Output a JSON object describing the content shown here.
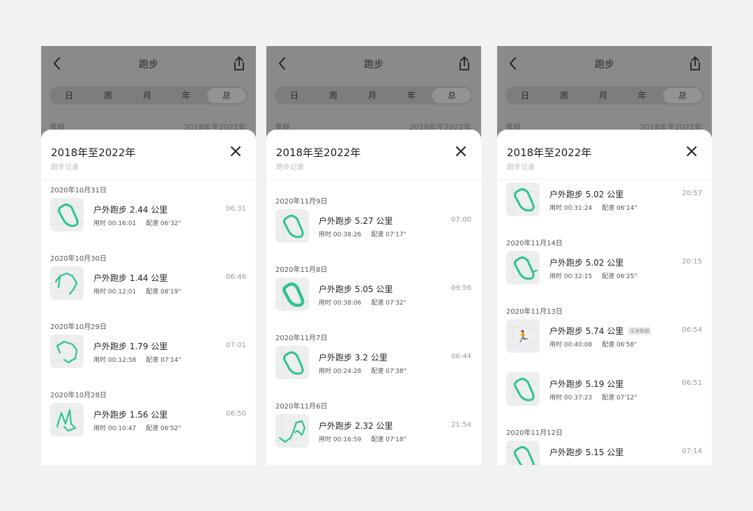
{
  "accent": "#2ec48d",
  "screens": [
    {
      "title": "跑步",
      "tabs": [
        "日",
        "周",
        "月",
        "年",
        "总"
      ],
      "active_tab": "总",
      "summary_label": "里程",
      "summary_range": "2018年至2022年",
      "sheet_title": "2018年至2022年",
      "sheet_subtitle": "跑步记录",
      "close_icon": "close-icon",
      "groups": [
        {
          "date": "2020年10月31日",
          "items": [
            {
              "title": "户外跑步 2.44 公里",
              "time": "06:31",
              "duration": "用时 00:16:01",
              "pace": "配速 06'32\"",
              "thumb": "loop"
            }
          ]
        },
        {
          "date": "2020年10月30日",
          "items": [
            {
              "title": "户外跑步 1.44 公里",
              "time": "06:46",
              "duration": "用时 00:12:01",
              "pace": "配速 08'19\"",
              "thumb": "route-a"
            }
          ]
        },
        {
          "date": "2020年10月29日",
          "items": [
            {
              "title": "户外跑步 1.79 公里",
              "time": "07:01",
              "duration": "用时 00:12:58",
              "pace": "配速 07'14\"",
              "thumb": "route-b"
            }
          ]
        },
        {
          "date": "2020年10月28日",
          "items": [
            {
              "title": "户外跑步 1.56 公里",
              "time": "06:50",
              "duration": "用时 00:10:47",
              "pace": "配速 06'52\"",
              "thumb": "zigzag"
            }
          ]
        }
      ]
    },
    {
      "title": "跑步",
      "tabs": [
        "日",
        "周",
        "月",
        "年",
        "总"
      ],
      "active_tab": "总",
      "summary_label": "里程",
      "summary_range": "2018年至2022年",
      "sheet_title": "2018年至2022年",
      "sheet_subtitle": "跑步记录",
      "close_icon": "close-icon",
      "groups": [
        {
          "date": "2020年11月9日",
          "items": [
            {
              "title": "户外跑步 5.27 公里",
              "time": "07:00",
              "duration": "用时 00:38:26",
              "pace": "配速 07'17\"",
              "thumb": "loop"
            }
          ]
        },
        {
          "date": "2020年11月8日",
          "items": [
            {
              "title": "户外跑步 5.05 公里",
              "time": "09:56",
              "duration": "用时 00:38:06",
              "pace": "配速 07'32\"",
              "thumb": "loop-bold"
            }
          ]
        },
        {
          "date": "2020年11月7日",
          "items": [
            {
              "title": "户外跑步 3.2 公里",
              "time": "06:44",
              "duration": "用时 00:24:28",
              "pace": "配速 07'38\"",
              "thumb": "loop"
            }
          ]
        },
        {
          "date": "2020年11月6日",
          "items": [
            {
              "title": "户外跑步 2.32 公里",
              "time": "21:54",
              "duration": "用时 00:16:59",
              "pace": "配速 07'18\"",
              "thumb": "route-c"
            }
          ]
        }
      ]
    },
    {
      "title": "跑步",
      "tabs": [
        "日",
        "周",
        "月",
        "年",
        "总"
      ],
      "active_tab": "总",
      "summary_label": "里程",
      "summary_range": "2018年至2022年",
      "sheet_title": "2018年至2022年",
      "sheet_subtitle": "跑步记录",
      "close_icon": "close-icon",
      "groups": [
        {
          "date": "",
          "items": [
            {
              "title": "户外跑步 5.02 公里",
              "time": "20:57",
              "duration": "用时 00:31:24",
              "pace": "配速 06'14\"",
              "thumb": "loop"
            }
          ]
        },
        {
          "date": "2020年11月14日",
          "items": [
            {
              "title": "户外跑步 5.02 公里",
              "time": "20:15",
              "duration": "用时 00:32:15",
              "pace": "配速 06'25\"",
              "thumb": "loop-tail"
            }
          ]
        },
        {
          "date": "2020年11月13日",
          "items": [
            {
              "title": "户外跑步 5.74 公里",
              "badge": "无效数据",
              "time": "06:54",
              "duration": "用时 00:40:08",
              "pace": "配速 06'58\"",
              "thumb": "runner"
            },
            {
              "title": "户外跑步 5.19 公里",
              "time": "06:51",
              "duration": "用时 00:37:23",
              "pace": "配速 07'12\"",
              "thumb": "loop"
            }
          ]
        },
        {
          "date": "2020年11月12日",
          "items": [
            {
              "title": "户外跑步 5.15 公里",
              "time": "07:14",
              "duration": "",
              "pace": "",
              "thumb": "loop"
            }
          ]
        }
      ]
    }
  ]
}
